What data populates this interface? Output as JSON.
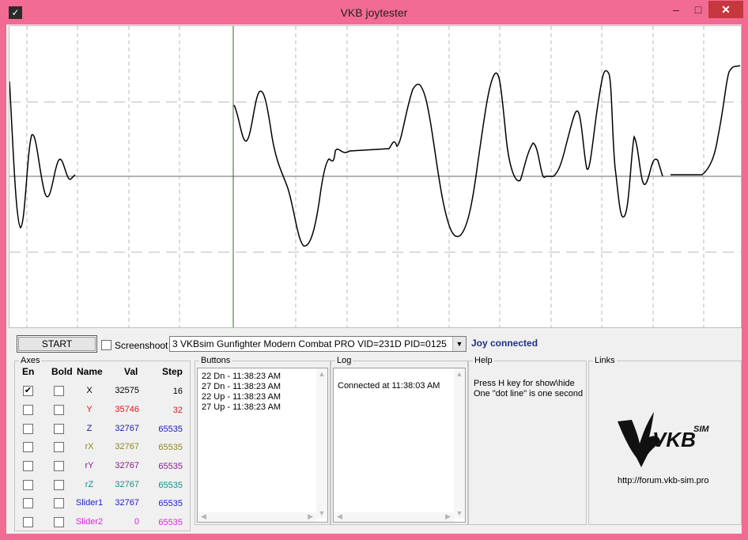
{
  "window": {
    "title": "VKB joytester",
    "minimize": "–",
    "maximize": "□",
    "close": "✕"
  },
  "colors": {
    "title_bar": "#f26b92",
    "close_button": "#c6373e",
    "joy_status": "#1d2f87",
    "trace": "#000000",
    "cursor_line": "#1a7a1a"
  },
  "toolbar": {
    "start_label": "START",
    "screenshoot_label": "Screenshoot",
    "screenshoot_checked": false,
    "device_selected": "3 VKBsim Gunfighter Modern Combat PRO  VID=231D PID=0125",
    "status": "Joy connected"
  },
  "axes": {
    "title": "Axes",
    "headers": {
      "en": "En",
      "bold": "Bold",
      "name": "Name",
      "val": "Val",
      "step": "Step"
    },
    "rows": [
      {
        "name": "X",
        "val": "32575",
        "step": "16",
        "enabled": true,
        "bold": false,
        "color": "#000000"
      },
      {
        "name": "Y",
        "val": "35746",
        "step": "32",
        "enabled": false,
        "bold": false,
        "color": "#e0141b"
      },
      {
        "name": "Z",
        "val": "32767",
        "step": "65535",
        "enabled": false,
        "bold": false,
        "color": "#1c1ca8"
      },
      {
        "name": "rX",
        "val": "32767",
        "step": "65535",
        "enabled": false,
        "bold": false,
        "color": "#8a8a1e"
      },
      {
        "name": "rY",
        "val": "32767",
        "step": "65535",
        "enabled": false,
        "bold": false,
        "color": "#8a1a8a"
      },
      {
        "name": "rZ",
        "val": "32767",
        "step": "65535",
        "enabled": false,
        "bold": false,
        "color": "#1a8a8a"
      },
      {
        "name": "Slider1",
        "val": "32767",
        "step": "65535",
        "enabled": false,
        "bold": false,
        "color": "#1c1ccc"
      },
      {
        "name": "Slider2",
        "val": "0",
        "step": "65535",
        "enabled": false,
        "bold": false,
        "color": "#e11ee1"
      }
    ]
  },
  "buttons_log": {
    "title": "Buttons",
    "entries": [
      "22 Dn - 11:38:23 AM",
      "27 Dn - 11:38:23 AM",
      "22 Up - 11:38:23 AM",
      "27 Up - 11:38:23 AM"
    ]
  },
  "log": {
    "title": "Log",
    "entries": [
      "Connected at 11:38:03 AM"
    ]
  },
  "help": {
    "title": "Help",
    "lines": [
      "Press H key for show\\hide",
      "One \"dot line\" is one second"
    ]
  },
  "links": {
    "title": "Links",
    "logo_text": "VKB",
    "logo_sup": "SIM",
    "url": "http://forum.vkb-sim.pro"
  },
  "scroll_icons": {
    "up": "▲",
    "down": "▼",
    "left": "◀",
    "right": "▶"
  }
}
